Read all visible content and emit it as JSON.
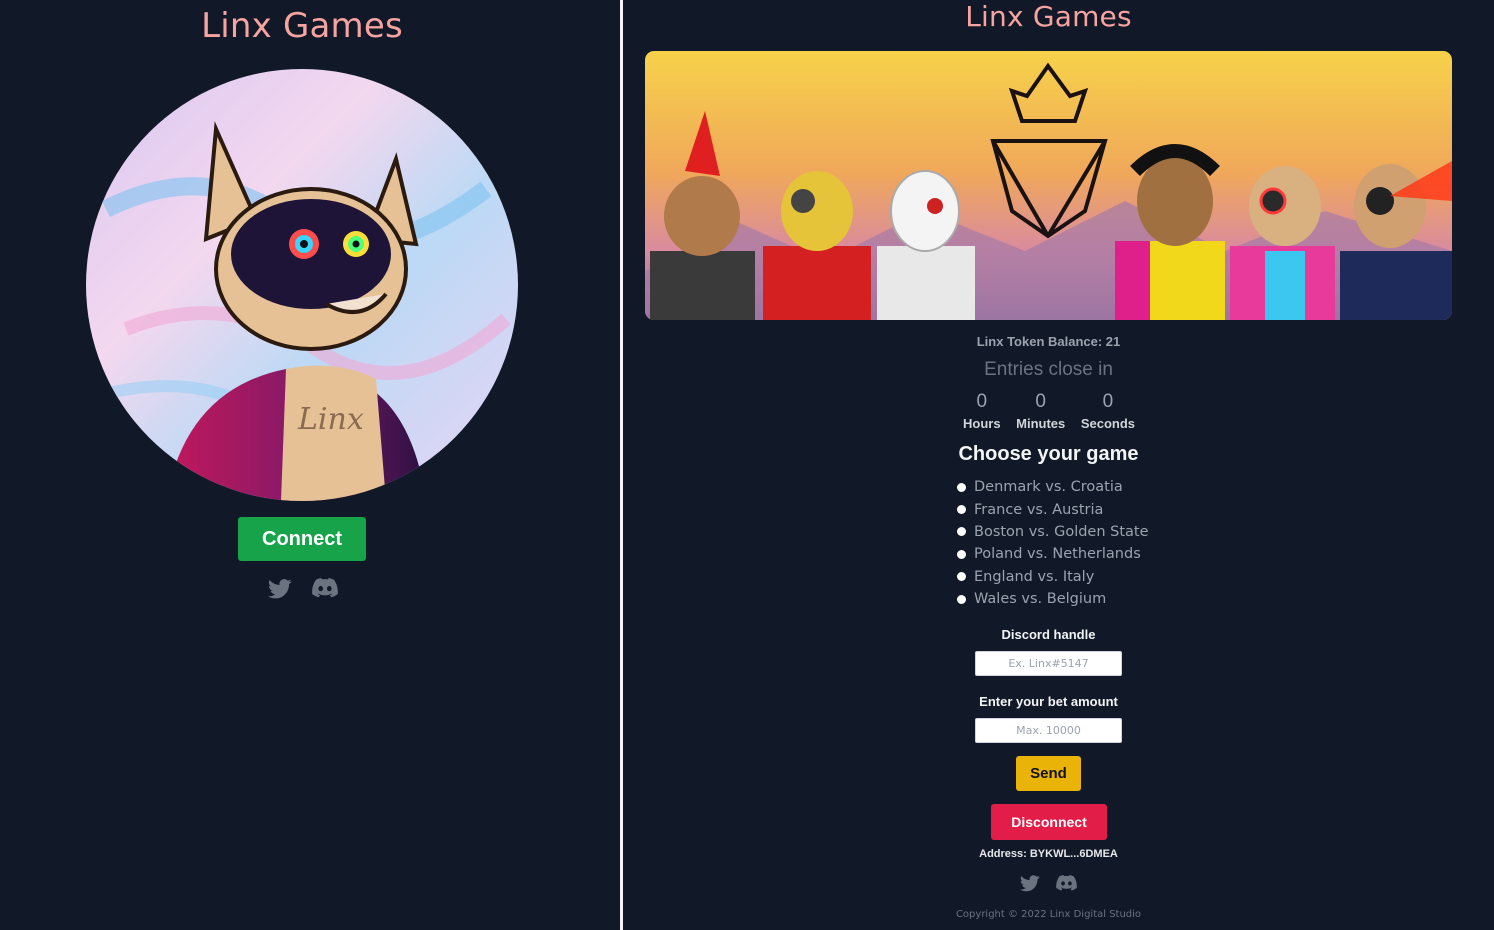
{
  "left": {
    "title": "Linx Games",
    "connect_label": "Connect",
    "socials": [
      "twitter-icon",
      "discord-icon"
    ]
  },
  "right": {
    "title": "Linx Games",
    "balance": "Linx Token Balance: 21",
    "entries_close": "Entries close in",
    "countdown": [
      {
        "value": "0",
        "label": "Hours"
      },
      {
        "value": "0",
        "label": "Minutes"
      },
      {
        "value": "0",
        "label": "Seconds"
      }
    ],
    "choose_heading": "Choose your game",
    "games": [
      "Denmark vs. Croatia",
      "France vs. Austria",
      "Boston vs. Golden State",
      "Poland vs. Netherlands",
      "England vs. Italy",
      "Wales vs. Belgium"
    ],
    "discord_label": "Discord handle",
    "discord_placeholder": "Ex. Linx#5147",
    "bet_label": "Enter your bet amount",
    "bet_placeholder": "Max. 10000",
    "send_label": "Send",
    "disconnect_label": "Disconnect",
    "address": "Address: BYKWL...6DMEA",
    "socials": [
      "twitter-icon",
      "discord-icon"
    ],
    "copyright": "Copyright © 2022 Linx Digital Studio"
  },
  "colors": {
    "background": "#111827",
    "brand": "#f7a3a0",
    "connect": "#16a34a",
    "send": "#eab308",
    "disconnect": "#e11d48"
  }
}
